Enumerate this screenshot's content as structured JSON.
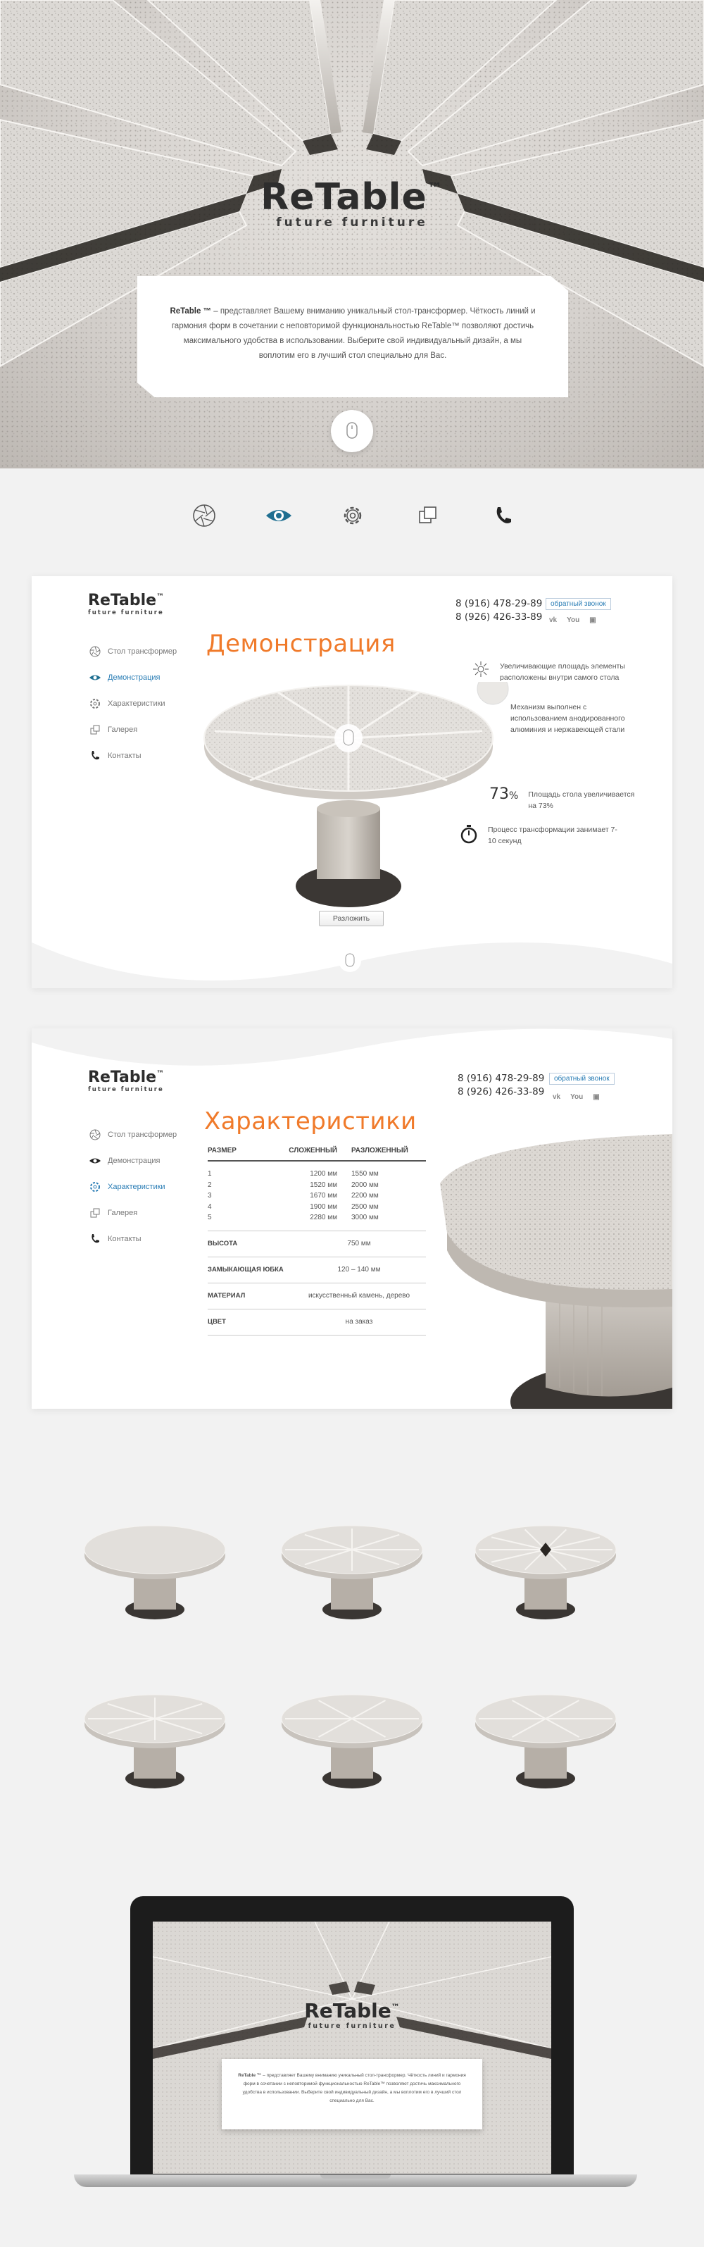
{
  "hero": {
    "brand": "ReTable",
    "tm": "™",
    "tagline": "future furniture",
    "intro_brand": "ReTable ™",
    "intro_text": " – представляет Вашему вниманию уникальный стол-трансформер. Чёткость линий и гармония форм в сочетании с неповторимой функциональностью ReTable™ позволяют достичь максимального удобства в использовании. Выберите свой индивидуальный дизайн, а мы воплотим его в лучший стол специально для Вас."
  },
  "nav_icons": [
    "aperture-icon",
    "eye-icon",
    "gear-icon",
    "gallery-icon",
    "phone-icon"
  ],
  "colors": {
    "accent": "#f07a2a",
    "link": "#2a7db5",
    "dark": "#2d2d2d",
    "bg": "#f2f2f2"
  },
  "header": {
    "brand": "ReTable",
    "tm": "™",
    "tagline": "future furniture",
    "phone1": "8 (916) 478-29-89",
    "phone2": "8 (926) 426-33-89",
    "callback": "обратный звонок",
    "socials": [
      "vk",
      "YouTube",
      "instagram"
    ]
  },
  "sidebar": [
    {
      "label": "Стол трансформер",
      "icon": "aperture-icon"
    },
    {
      "label": "Демонстрация",
      "icon": "eye-icon"
    },
    {
      "label": "Характеристики",
      "icon": "gear-icon"
    },
    {
      "label": "Галерея",
      "icon": "gallery-icon"
    },
    {
      "label": "Контакты",
      "icon": "phone-icon"
    }
  ],
  "demo": {
    "title": "Демонстрация",
    "f1": "Увеличивающие площадь элементы расположены внутри самого стола",
    "f2": "Механизм выполнен с использованием анодированного алюминия и нержавеющей стали",
    "f3_pct": "73",
    "f3_unit": "%",
    "f3_text": "Площадь стола увеличивается на 73%",
    "f4": "Процесс трансформации занимает 7-10 секунд",
    "unfold": "Разложить"
  },
  "specs": {
    "title": "Характеристики",
    "headers": [
      "РАЗМЕР",
      "СЛОЖЕННЫЙ",
      "РАЗЛОЖЕННЫЙ"
    ],
    "rows": [
      [
        "1",
        "1200 мм",
        "1550 мм"
      ],
      [
        "2",
        "1520 мм",
        "2000 мм"
      ],
      [
        "3",
        "1670 мм",
        "2200 мм"
      ],
      [
        "4",
        "1900 мм",
        "2500 мм"
      ],
      [
        "5",
        "2280 мм",
        "3000 мм"
      ]
    ],
    "props": [
      {
        "name": "ВЫСОТА",
        "value": "750 мм"
      },
      {
        "name": "ЗАМЫКАЮЩАЯ ЮБКА",
        "value": "120 – 140 мм"
      },
      {
        "name": "МАТЕРИАЛ",
        "value": "искусственный камень, дерево"
      },
      {
        "name": "ЦВЕТ",
        "value": "на заказ"
      }
    ]
  },
  "laptop": {
    "brand": "ReTable",
    "tm": "™",
    "tagline": "future furniture",
    "intro_brand": "ReTable ™",
    "intro_text": " – представляет Вашему вниманию уникальный стол-трансформер. Чёткость линий и гармония форм в сочетании с неповторимой функциональностью ReTable™ позволяют достичь максимального удобства в использовании. Выберите свой индивидуальный дизайн, а мы воплотим его в лучший стол специально для Вас."
  }
}
